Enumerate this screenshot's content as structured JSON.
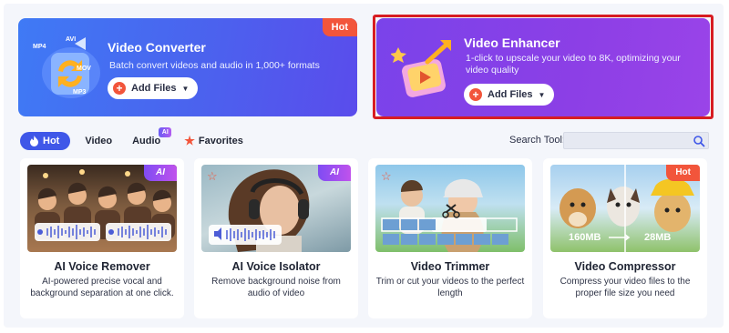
{
  "banners": {
    "converter": {
      "title": "Video Converter",
      "description": "Batch convert videos and audio in 1,000+ formats",
      "button": "Add Files",
      "formats": [
        "MP4",
        "AVI",
        "MOV",
        "MP3"
      ],
      "tag": "Hot"
    },
    "enhancer": {
      "title": "Video Enhancer",
      "description": "1-click to upscale your video to 8K, optimizing your video quality",
      "button": "Add Files"
    }
  },
  "tabs": [
    {
      "label": "Hot",
      "active": true,
      "icon": "flame-icon"
    },
    {
      "label": "Video"
    },
    {
      "label": "Audio",
      "badge": "AI"
    },
    {
      "label": "Favorites",
      "icon": "star-icon"
    }
  ],
  "search": {
    "label": "Search Tool:",
    "placeholder": ""
  },
  "cards": [
    {
      "title": "AI Voice Remover",
      "description": "AI-powered precise vocal and background separation at one click.",
      "badge": "AI"
    },
    {
      "title": "AI Voice Isolator",
      "description": "Remove background noise from audio of video",
      "badge": "AI"
    },
    {
      "title": "Video Trimmer",
      "description": "Trim or cut your videos to the perfect length"
    },
    {
      "title": "Video Compressor",
      "description": "Compress your video files to the proper file size you need",
      "badge": "Hot",
      "size_from": "160MB",
      "size_to": "28MB"
    }
  ],
  "colors": {
    "accent": "#3f57e8",
    "hot": "#f2553b",
    "enhancer_outline": "#d71d22"
  }
}
